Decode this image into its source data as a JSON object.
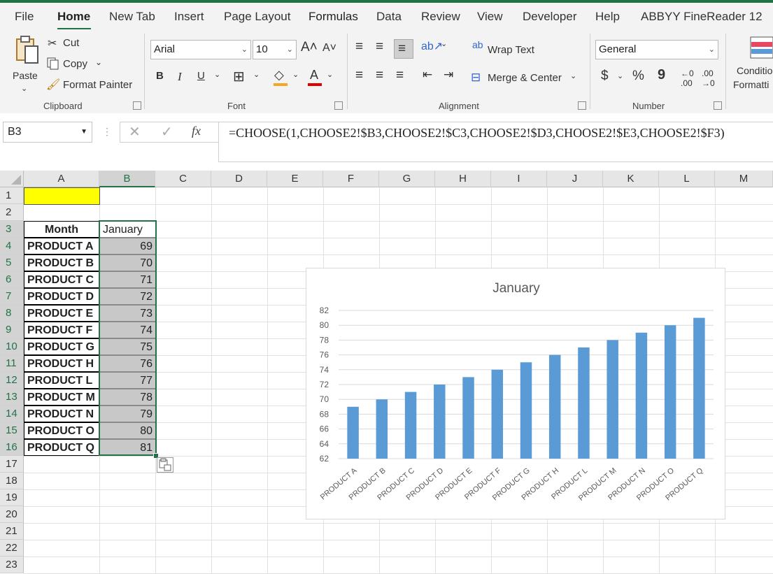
{
  "tabs": [
    "File",
    "Home",
    "New Tab",
    "Insert",
    "Page Layout",
    "Formulas",
    "Data",
    "Review",
    "View",
    "Developer",
    "Help",
    "ABBYY FineReader 12"
  ],
  "ribbon": {
    "clipboard": {
      "paste": "Paste",
      "cut": "Cut",
      "copy": "Copy",
      "format_painter": "Format Painter",
      "label": "Clipboard"
    },
    "font": {
      "name": "Arial",
      "size": "10",
      "bold": "B",
      "italic": "I",
      "underline": "U",
      "label": "Font"
    },
    "alignment": {
      "wrap_text": "Wrap Text",
      "merge_center": "Merge & Center",
      "label": "Alignment"
    },
    "number": {
      "format": "General",
      "currency": "$",
      "percent": "%",
      "comma": "9",
      "label": "Number"
    },
    "styles": {
      "conditional_1": "Conditio",
      "conditional_2": "Formatti"
    }
  },
  "formula_bar": {
    "name_box": "B3",
    "fx": "fx",
    "formula": "=CHOOSE(1,CHOOSE2!$B3,CHOOSE2!$C3,CHOOSE2!$D3,CHOOSE2!$E3,CHOOSE2!$F3)"
  },
  "columns": [
    "A",
    "B",
    "C",
    "D",
    "E",
    "F",
    "G",
    "H",
    "I",
    "J",
    "K",
    "L",
    "M"
  ],
  "rows": [
    "1",
    "2",
    "3",
    "4",
    "5",
    "6",
    "7",
    "8",
    "9",
    "10",
    "11",
    "12",
    "13",
    "14",
    "15",
    "16",
    "17",
    "18",
    "19",
    "20",
    "21",
    "22",
    "23"
  ],
  "table": {
    "header": {
      "month": "Month",
      "value": "January"
    },
    "rows": [
      {
        "name": "PRODUCT A",
        "value": "69"
      },
      {
        "name": "PRODUCT B",
        "value": "70"
      },
      {
        "name": "PRODUCT C",
        "value": "71"
      },
      {
        "name": "PRODUCT D",
        "value": "72"
      },
      {
        "name": "PRODUCT E",
        "value": "73"
      },
      {
        "name": "PRODUCT F",
        "value": "74"
      },
      {
        "name": "PRODUCT G",
        "value": "75"
      },
      {
        "name": "PRODUCT H",
        "value": "76"
      },
      {
        "name": "PRODUCT L",
        "value": "77"
      },
      {
        "name": "PRODUCT M",
        "value": "78"
      },
      {
        "name": "PRODUCT N",
        "value": "79"
      },
      {
        "name": "PRODUCT O",
        "value": "80"
      },
      {
        "name": "PRODUCT Q",
        "value": "81"
      }
    ]
  },
  "colors": {
    "accent": "#217346",
    "highlight": "#ffff00",
    "bar": "#5b9bd5",
    "range_fill": "#c8c8c8"
  },
  "chart_data": {
    "type": "bar",
    "title": "January",
    "categories": [
      "PRODUCT A",
      "PRODUCT B",
      "PRODUCT C",
      "PRODUCT D",
      "PRODUCT E",
      "PRODUCT F",
      "PRODUCT G",
      "PRODUCT H",
      "PRODUCT L",
      "PRODUCT M",
      "PRODUCT N",
      "PRODUCT O",
      "PRODUCT Q"
    ],
    "values": [
      69,
      70,
      71,
      72,
      73,
      74,
      75,
      76,
      77,
      78,
      79,
      80,
      81
    ],
    "ylim": [
      62,
      82
    ],
    "yticks": [
      62,
      64,
      66,
      68,
      70,
      72,
      74,
      76,
      78,
      80,
      82
    ],
    "grid": true
  }
}
